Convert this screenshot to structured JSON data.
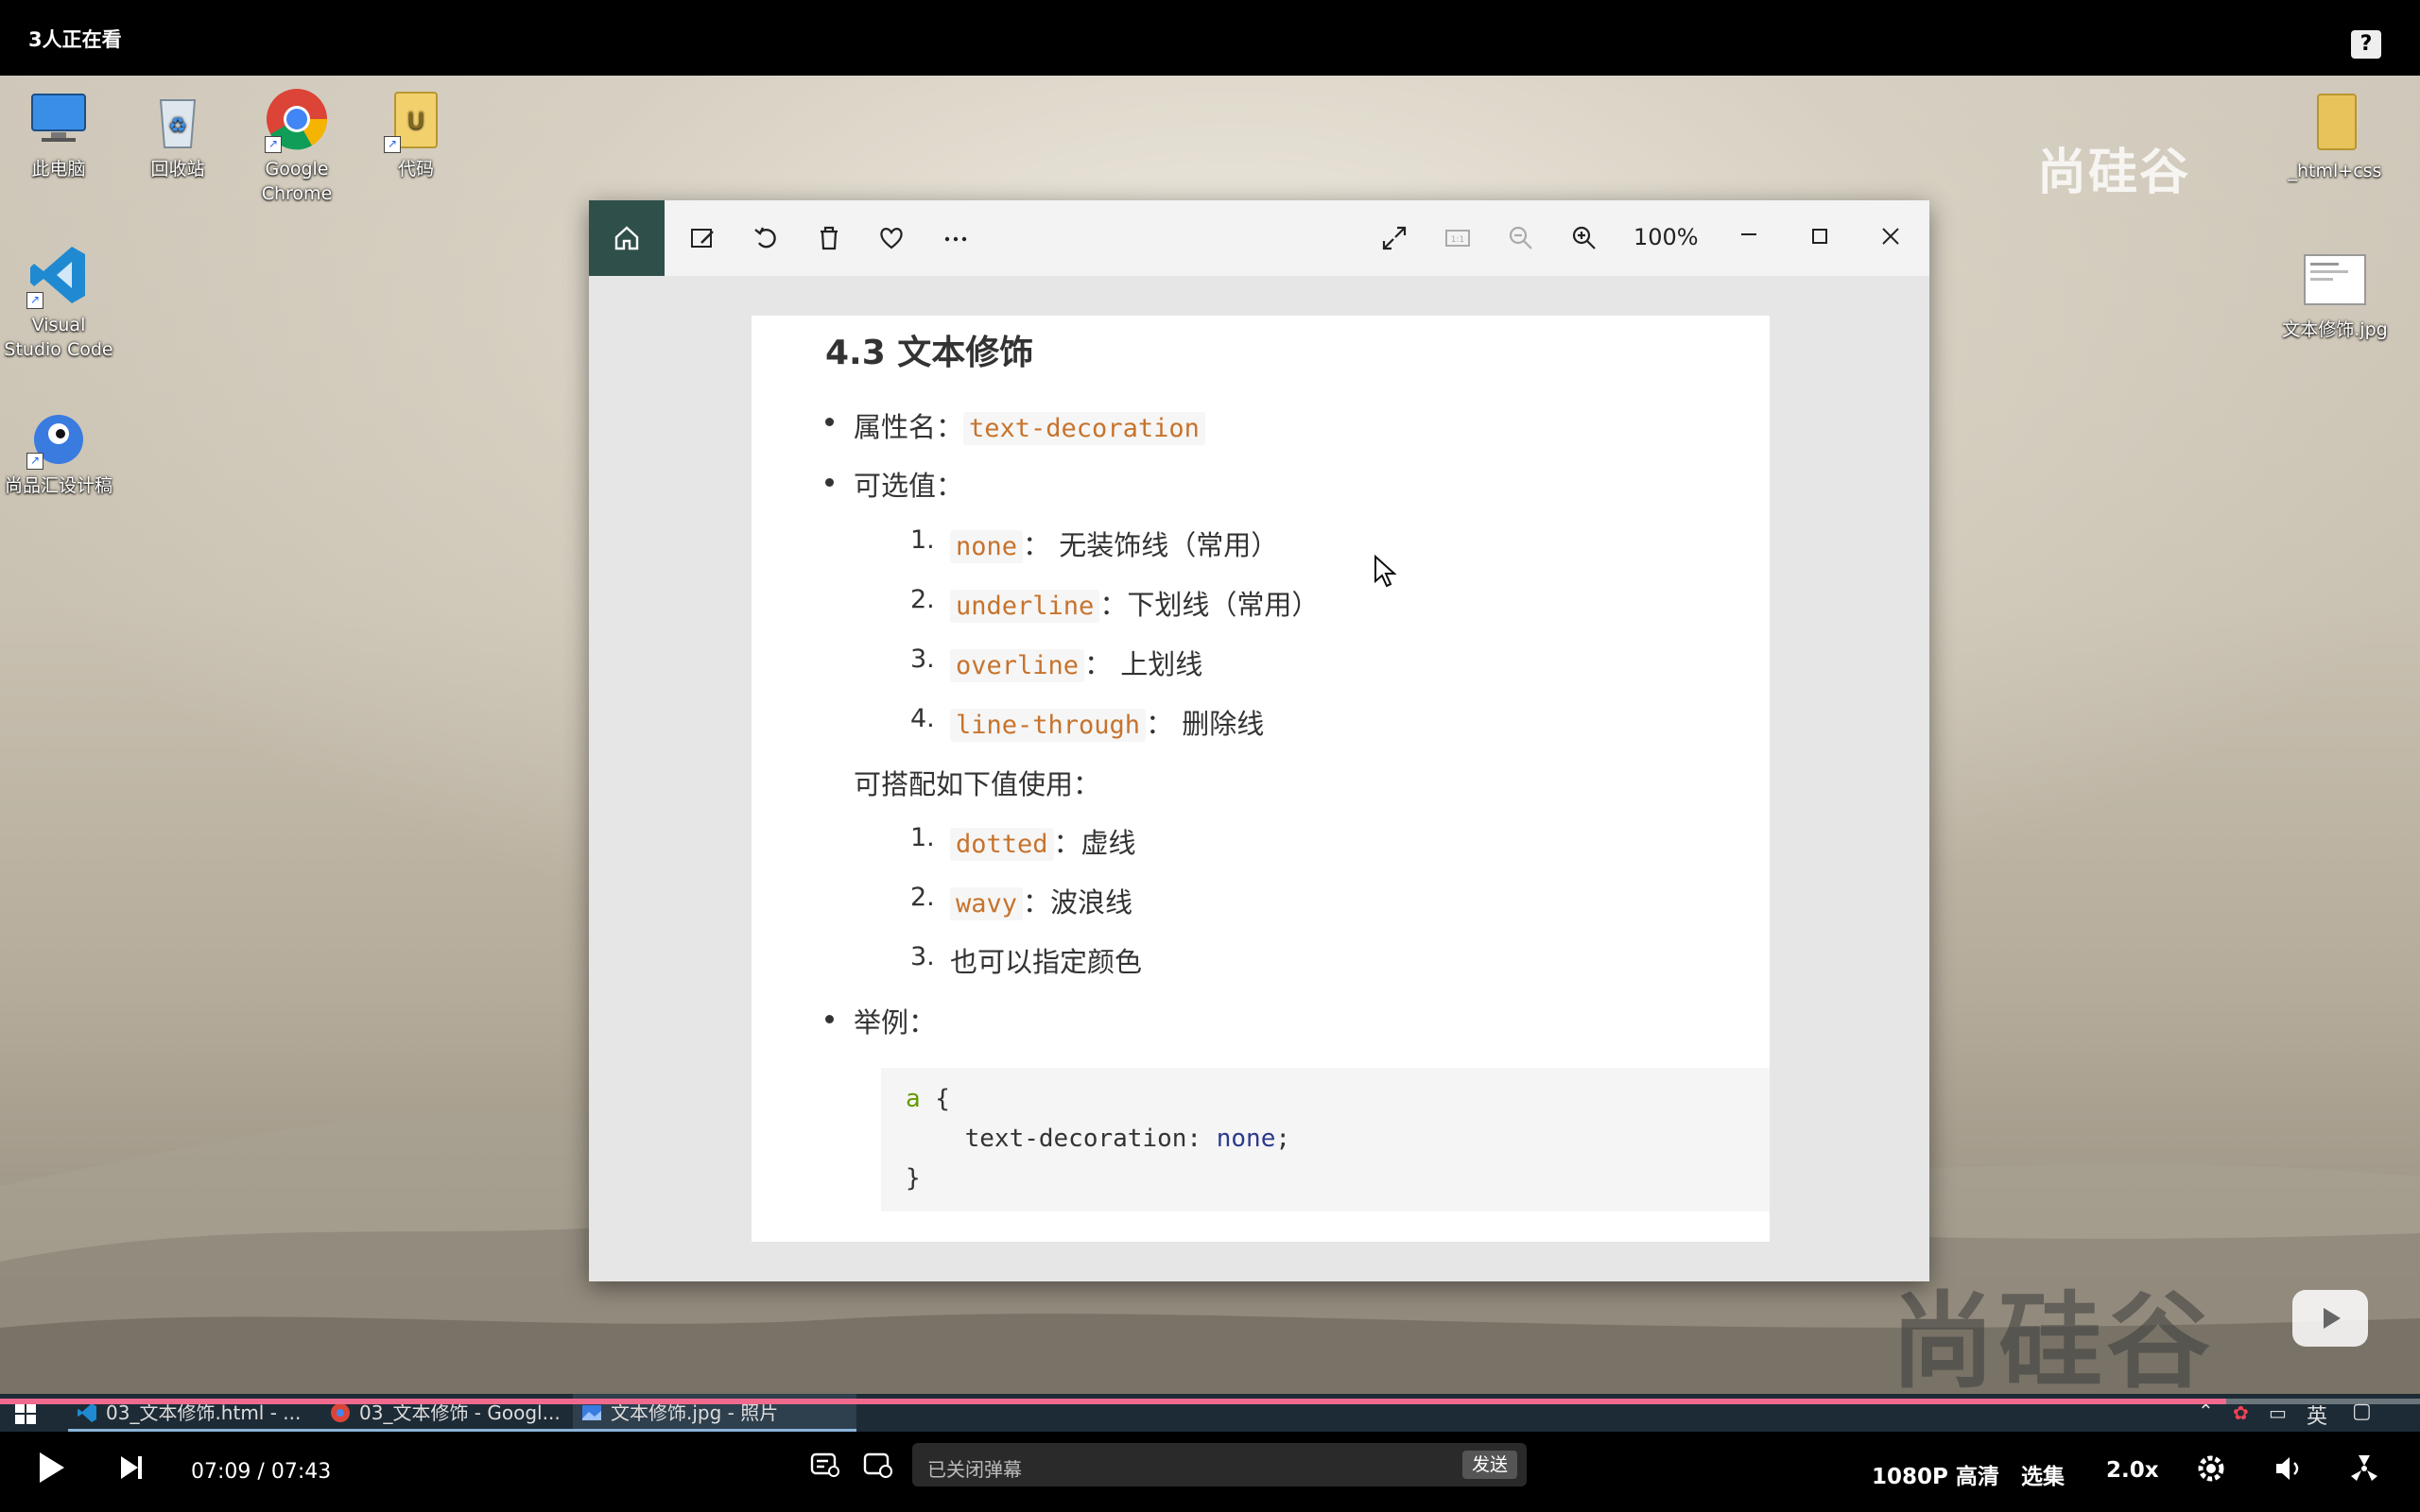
{
  "player": {
    "viewer_count": "3人正在看",
    "current_time": "07:09",
    "separator": "/",
    "total_time": "07:43",
    "progress": 0.92,
    "danmaku_placeholder": "已关闭弹幕",
    "send_label": "发送",
    "quality_label": "1080P 高清",
    "episodes_label": "选集",
    "speed_label": "2.0x",
    "accent_color": "#f06a8e"
  },
  "desktop": {
    "icons": [
      {
        "label": "此电脑"
      },
      {
        "label": "回收站"
      },
      {
        "label": "Google Chrome"
      },
      {
        "label": "代码"
      },
      {
        "label": "Visual Studio Code"
      },
      {
        "label": "尚品汇设计稿"
      },
      {
        "label": "_html+css"
      },
      {
        "label": "文本修饰.jpg"
      }
    ],
    "watermark_text": "尚硅谷"
  },
  "viewer": {
    "zoom": "100%"
  },
  "document": {
    "heading": "4.3 文本修饰",
    "prop_label": "属性名：",
    "prop_code": "text-decoration",
    "values_label": "可选值：",
    "values": [
      {
        "num": "1.",
        "code": "none",
        "desc": "：  无装饰线（常用）"
      },
      {
        "num": "2.",
        "code": "underline",
        "desc": "：下划线（常用）"
      },
      {
        "num": "3.",
        "code": "overline",
        "desc": "：  上划线"
      },
      {
        "num": "4.",
        "code": "line-through",
        "desc": "：  删除线"
      }
    ],
    "combo_label": "可搭配如下值使用：",
    "combos": [
      {
        "num": "1.",
        "code": "dotted",
        "desc": "：虚线"
      },
      {
        "num": "2.",
        "code": "wavy",
        "desc": "：波浪线"
      },
      {
        "num": "3.",
        "code": "",
        "desc": "也可以指定颜色"
      }
    ],
    "example_label": "举例：",
    "code_lines": {
      "l1_sel": "a",
      "l1_brace": " {",
      "l2_prop": "    text-decoration",
      "l2_colon": ": ",
      "l2_val": "none",
      "l2_end": ";",
      "l3": "}"
    }
  },
  "taskbar": {
    "items": [
      {
        "label": "03_文本修饰.html - ..."
      },
      {
        "label": "03_文本修饰 - Googl..."
      },
      {
        "label": "文本修饰.jpg - 照片"
      }
    ],
    "ime_label": "英"
  }
}
